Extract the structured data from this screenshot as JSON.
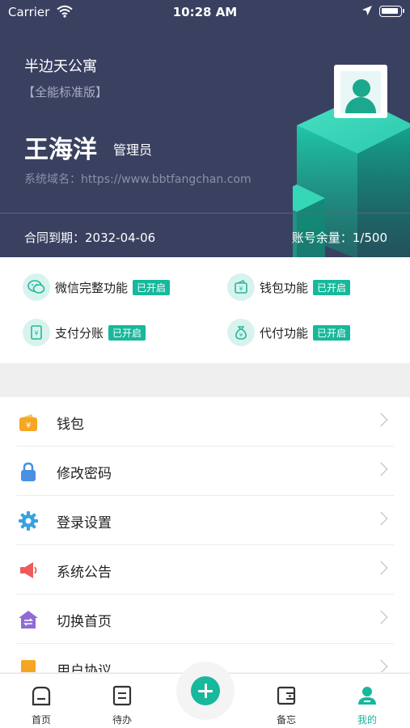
{
  "status_bar": {
    "carrier": "Carrier",
    "time": "10:28 AM"
  },
  "header": {
    "company": "半边天公寓",
    "edition": "【全能标准版】",
    "user_name": "王海洋",
    "role": "管理员",
    "domain": "系统域名：https://www.bbtfangchan.com",
    "contract": "合同到期：2032-04-06",
    "quota": "账号余量：1/500"
  },
  "features": [
    {
      "label": "微信完整功能",
      "status": "已开启",
      "icon": "wechat-icon"
    },
    {
      "label": "钱包功能",
      "status": "已开启",
      "icon": "wallet-icon"
    },
    {
      "label": "支付分账",
      "status": "已开启",
      "icon": "split-pay-icon"
    },
    {
      "label": "代付功能",
      "status": "已开启",
      "icon": "money-bag-icon"
    }
  ],
  "menu": [
    {
      "label": "钱包",
      "icon": "wallet-icon",
      "color": "#f5a623"
    },
    {
      "label": "修改密码",
      "icon": "lock-icon",
      "color": "#4a90e2"
    },
    {
      "label": "登录设置",
      "icon": "gear-icon",
      "color": "#3aa0e0"
    },
    {
      "label": "系统公告",
      "icon": "megaphone-icon",
      "color": "#f05a5a"
    },
    {
      "label": "切换首页",
      "icon": "switch-home-icon",
      "color": "#8e6bd6"
    },
    {
      "label": "用户协议",
      "icon": "document-icon",
      "color": "#f5a623"
    }
  ],
  "tabbar": {
    "tabs": [
      {
        "label": "首页",
        "icon": "home-icon"
      },
      {
        "label": "待办",
        "icon": "todo-icon"
      },
      {
        "label": "备忘",
        "icon": "memo-icon"
      },
      {
        "label": "我的",
        "icon": "profile-icon",
        "active": true
      }
    ],
    "add_icon": "plus-icon"
  },
  "colors": {
    "header_bg": "#3a4060",
    "accent": "#17b89b"
  }
}
